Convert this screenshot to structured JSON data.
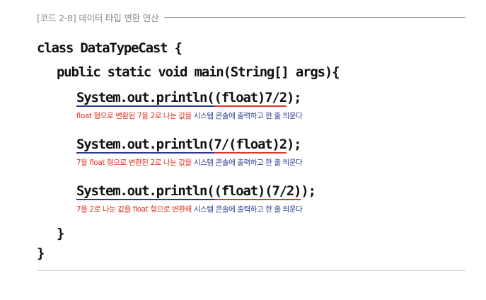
{
  "caption": "[코드 2-8] 데이터 타입 변환 연산",
  "code": {
    "class_decl": "class DataTypeCast {",
    "method_decl": "public static void main(String[] args){",
    "statements": [
      {
        "prefix": "System.out.println(",
        "cast": "(float)7/2",
        "suffix": ");",
        "note_red": "float 형으로 변환된 7을 2로 나눈 값을",
        "note_blue": " 시스템 콘솔에 출력하고 한 줄 띄운다"
      },
      {
        "prefix": "System.out.println(",
        "cast": "7/(float)2",
        "suffix": ");",
        "note_red": "7을 float 형으로 변환된 2로 나눈 값을",
        "note_blue": " 시스템 콘솔에 출력하고 한 줄 띄운다"
      },
      {
        "prefix": "System.out.println(",
        "cast": "(float)(7/2)",
        "suffix": ");",
        "note_red": "7을 2로 나눈 값을 float 형으로 변환해",
        "note_blue": " 시스템 콘솔에 출력하고 한 줄 띄운다"
      }
    ],
    "method_close": "}",
    "class_close": "}"
  },
  "colors": {
    "underline_blue": "#2b3a8f",
    "underline_red": "#d8392b",
    "note_red": "#e0301e",
    "note_blue": "#2b3a8f"
  }
}
